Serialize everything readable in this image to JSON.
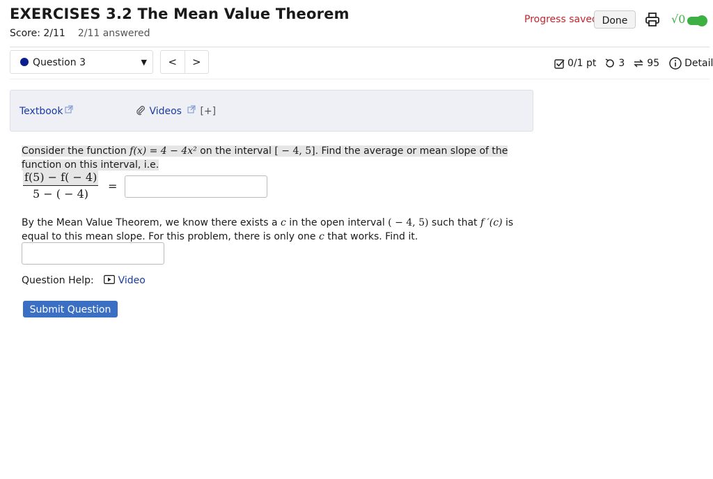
{
  "header": {
    "title": "EXERCISES 3.2 The Mean Value Theorem",
    "score": "Score: 2/11",
    "answered": "2/11 answered",
    "progress": "Progress saved",
    "done": "Done",
    "sqrt_label": "√0"
  },
  "nav": {
    "question": "Question 3",
    "prev": "<",
    "next": ">"
  },
  "meta": {
    "points": "0/1 pt",
    "retries": "3",
    "attempts": "95",
    "details": "Details"
  },
  "resources": {
    "textbook": "Textbook",
    "videos": "Videos",
    "expand": "[+]"
  },
  "problem": {
    "p1_a": "Consider the function ",
    "func": "f(x) = 4 − 4x²",
    "p1_b": " on the interval ",
    "interval": "[ − 4, 5]",
    "p1_c": ". Find the average or mean slope of the function on this interval, i.e.",
    "frac_num": "f(5) − f( − 4)",
    "frac_den": "5 − ( − 4)",
    "equals": "=",
    "p2_a": "By the Mean Value Theorem, we know there exists a ",
    "c": "c",
    "p2_b": " in the open interval ",
    "open_interval": "( − 4, 5)",
    "p2_c": " such that ",
    "fprime": "f ′(c)",
    "p2_d": " is equal to this mean slope. For this problem, there is only one ",
    "p2_e": " that works. Find it.",
    "help_label": "Question Help:",
    "help_video": "Video",
    "submit": "Submit Question"
  },
  "colors": {
    "accent": "#3b6fc4",
    "link": "#1a3aa8",
    "saved": "#c0272d",
    "toggle": "#3cb043"
  }
}
